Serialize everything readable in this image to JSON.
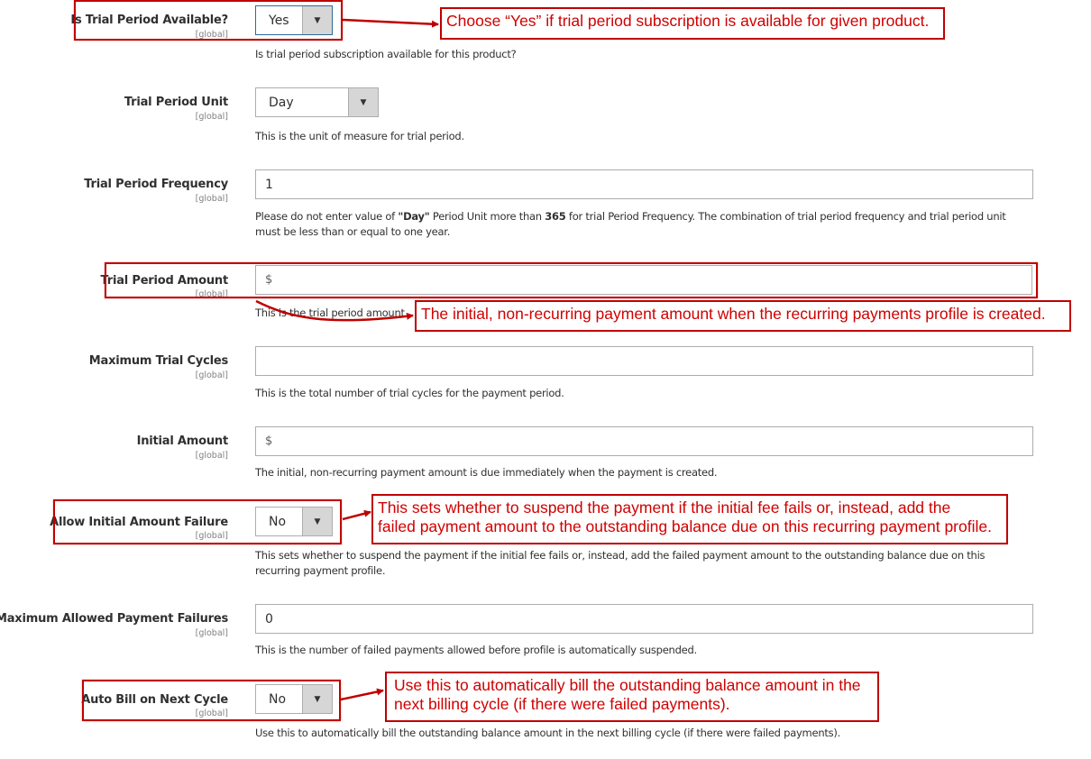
{
  "scope_label": "[global]",
  "fields": {
    "trial_available": {
      "label": "Is Trial Period Available?",
      "value": "Yes",
      "note": "Is trial period subscription available for this product?"
    },
    "trial_unit": {
      "label": "Trial Period Unit",
      "value": "Day",
      "note": "This is the unit of measure for trial period."
    },
    "trial_frequency": {
      "label": "Trial Period Frequency",
      "value": "1",
      "note_part1": "Please do not enter value of ",
      "note_bold1": "\"Day\"",
      "note_part2": " Period Unit more than ",
      "note_bold2": "365",
      "note_part3": " for trial Period Frequency. The combination of trial period frequency and trial period unit must be less than or equal to one year."
    },
    "trial_amount": {
      "label": "Trial Period Amount",
      "prefix": "$",
      "value": "",
      "note": "This is the trial period amount."
    },
    "max_trial_cycles": {
      "label": "Maximum Trial Cycles",
      "value": "",
      "note": "This is the total number of trial cycles for the payment period."
    },
    "initial_amount": {
      "label": "Initial Amount",
      "prefix": "$",
      "value": "",
      "note": "The initial, non-recurring payment amount is due immediately when the payment is created."
    },
    "allow_initial_failure": {
      "label": "Allow Initial Amount Failure",
      "value": "No",
      "note": "This sets whether to suspend the payment if the initial fee fails or, instead, add the failed payment amount to the outstanding balance due on this recurring payment profile."
    },
    "max_payment_failures": {
      "label": "Maximum Allowed Payment Failures",
      "value": "0",
      "note": "This is the number of failed payments allowed before profile is automatically suspended."
    },
    "auto_bill": {
      "label": "Auto Bill on Next Cycle",
      "value": "No",
      "note": "Use this to automatically bill the outstanding balance amount in the next billing cycle (if there were failed payments)."
    }
  },
  "callouts": {
    "trial_available": "Choose “Yes” if trial period subscription is available for given product.",
    "trial_amount": "The initial, non-recurring payment amount when the recurring payments profile is created.",
    "allow_initial_failure_line1": "This sets whether to suspend the payment if the initial fee fails or, instead, add the",
    "allow_initial_failure_line2": "failed payment amount to the outstanding balance due on this recurring payment profile.",
    "auto_bill_line1": "Use this to automatically bill the outstanding balance amount in the",
    "auto_bill_line2": "next billing cycle (if there were failed payments)."
  },
  "colors": {
    "annotation": "#c00000",
    "annotation_text": "#d00000",
    "select_arrow_bg": "#d6d6d6",
    "focus_border": "#2e6b9b"
  }
}
